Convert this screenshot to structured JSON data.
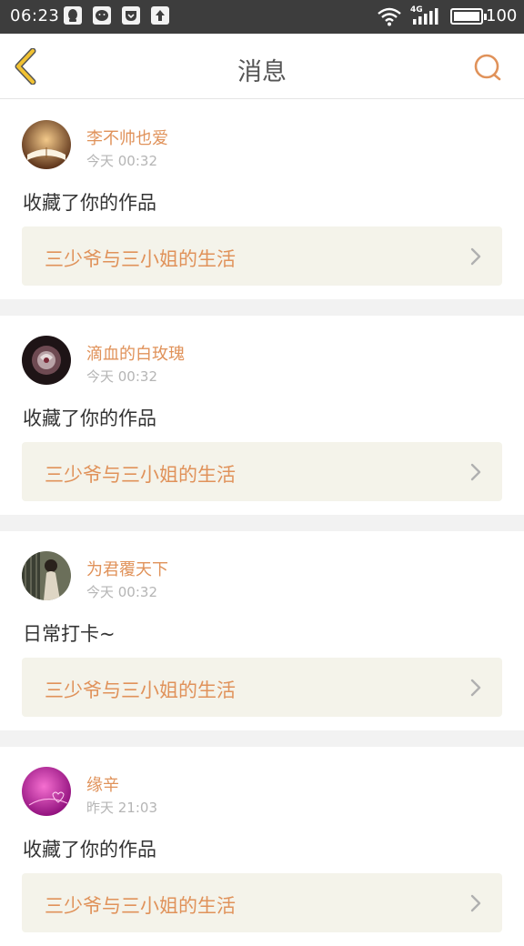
{
  "status_bar": {
    "time": "06:23",
    "network": "4G",
    "battery": "100"
  },
  "header": {
    "title": "消息"
  },
  "messages": [
    {
      "user": "李不帅也爱",
      "time": "今天 00:32",
      "action": "收藏了你的作品",
      "work": "三少爷与三小姐的生活"
    },
    {
      "user": "滴血的白玫瑰",
      "time": "今天 00:32",
      "action": "收藏了你的作品",
      "work": "三少爷与三小姐的生活"
    },
    {
      "user": "为君覆天下",
      "time": "今天 00:32",
      "action": "日常打卡~",
      "work": "三少爷与三小姐的生活"
    },
    {
      "user": "缘辛",
      "time": "昨天 21:03",
      "action": "收藏了你的作品",
      "work": "三少爷与三小姐的生活"
    }
  ],
  "colors": {
    "accent": "#e0925a",
    "back_arrow": "#e6b800",
    "status_bar": "#3d3d3d",
    "link_bg": "#f4f3ea"
  }
}
